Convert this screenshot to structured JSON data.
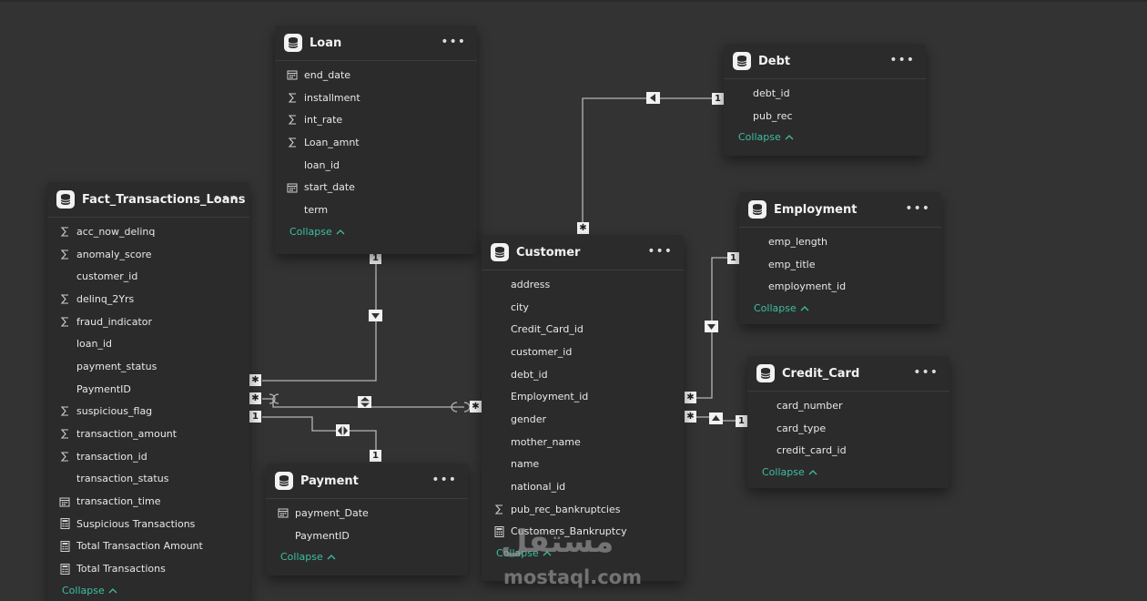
{
  "tables": {
    "loan": {
      "title": "Loan",
      "fields": [
        {
          "icon": "calendar-icon",
          "name": "end_date"
        },
        {
          "icon": "sigma-icon",
          "name": "installment"
        },
        {
          "icon": "sigma-icon",
          "name": "int_rate"
        },
        {
          "icon": "sigma-icon",
          "name": "Loan_amnt"
        },
        {
          "icon": "",
          "name": "loan_id"
        },
        {
          "icon": "calendar-icon",
          "name": "start_date"
        },
        {
          "icon": "",
          "name": "term"
        }
      ],
      "collapse": "Collapse"
    },
    "debt": {
      "title": "Debt",
      "fields": [
        {
          "icon": "",
          "name": "debt_id"
        },
        {
          "icon": "",
          "name": "pub_rec"
        }
      ],
      "collapse": "Collapse"
    },
    "fact": {
      "title": "Fact_Transactions_Loans",
      "fields": [
        {
          "icon": "sigma-icon",
          "name": "acc_now_delinq"
        },
        {
          "icon": "sigma-icon",
          "name": "anomaly_score"
        },
        {
          "icon": "",
          "name": "customer_id"
        },
        {
          "icon": "sigma-icon",
          "name": "delinq_2Yrs"
        },
        {
          "icon": "sigma-icon",
          "name": "fraud_indicator"
        },
        {
          "icon": "",
          "name": "loan_id"
        },
        {
          "icon": "",
          "name": "payment_status"
        },
        {
          "icon": "",
          "name": "PaymentID"
        },
        {
          "icon": "sigma-icon",
          "name": "suspicious_flag"
        },
        {
          "icon": "sigma-icon",
          "name": "transaction_amount"
        },
        {
          "icon": "sigma-icon",
          "name": "transaction_id"
        },
        {
          "icon": "",
          "name": "transaction_status"
        },
        {
          "icon": "calendar-icon",
          "name": "transaction_time"
        },
        {
          "icon": "calculator-icon",
          "name": "Suspicious Transactions"
        },
        {
          "icon": "calculator-icon",
          "name": "Total Transaction Amount"
        },
        {
          "icon": "calculator-icon",
          "name": "Total Transactions"
        }
      ],
      "collapse": "Collapse"
    },
    "customer": {
      "title": "Customer",
      "fields": [
        {
          "icon": "",
          "name": "address"
        },
        {
          "icon": "",
          "name": "city"
        },
        {
          "icon": "",
          "name": "Credit_Card_id"
        },
        {
          "icon": "",
          "name": "customer_id"
        },
        {
          "icon": "",
          "name": "debt_id"
        },
        {
          "icon": "",
          "name": "Employment_id"
        },
        {
          "icon": "",
          "name": "gender"
        },
        {
          "icon": "",
          "name": "mother_name"
        },
        {
          "icon": "",
          "name": "name"
        },
        {
          "icon": "",
          "name": "national_id"
        },
        {
          "icon": "sigma-icon",
          "name": "pub_rec_bankruptcies"
        },
        {
          "icon": "calculator-icon",
          "name": "Customers_Bankruptcy"
        }
      ],
      "collapse": "Collapse"
    },
    "employment": {
      "title": "Employment",
      "fields": [
        {
          "icon": "",
          "name": "emp_length"
        },
        {
          "icon": "",
          "name": "emp_title"
        },
        {
          "icon": "",
          "name": "employment_id"
        }
      ],
      "collapse": "Collapse"
    },
    "credit_card": {
      "title": "Credit_Card",
      "fields": [
        {
          "icon": "",
          "name": "card_number"
        },
        {
          "icon": "",
          "name": "card_type"
        },
        {
          "icon": "",
          "name": "credit_card_id"
        }
      ],
      "collapse": "Collapse"
    },
    "payment": {
      "title": "Payment",
      "fields": [
        {
          "icon": "calendar-icon",
          "name": "payment_Date"
        },
        {
          "icon": "",
          "name": "PaymentID"
        }
      ],
      "collapse": "Collapse"
    }
  },
  "relationships": [
    {
      "from": "Customer",
      "to": "Debt",
      "from_card": "*",
      "to_card": "1"
    },
    {
      "from": "Fact_Transactions_Loans",
      "to": "Loan",
      "from_card": "*",
      "to_card": "1"
    },
    {
      "from": "Fact_Transactions_Loans",
      "to": "Customer",
      "from_card": "*",
      "to_card": "*"
    },
    {
      "from": "Fact_Transactions_Loans",
      "to": "Payment",
      "from_card": "1",
      "to_card": "1"
    },
    {
      "from": "Customer",
      "to": "Employment",
      "from_card": "*",
      "to_card": "1"
    },
    {
      "from": "Customer",
      "to": "Credit_Card",
      "from_card": "*",
      "to_card": "1"
    }
  ],
  "menu_glyph": "•••",
  "cardinality": {
    "one": "1",
    "many": "✱"
  },
  "watermark": {
    "arabic": "مستقل",
    "latin": "mostaql.com"
  },
  "colors": {
    "background": "#333333",
    "card": "#2b2b2b",
    "link": "#3dbfa0",
    "line": "#b5b5b5"
  }
}
